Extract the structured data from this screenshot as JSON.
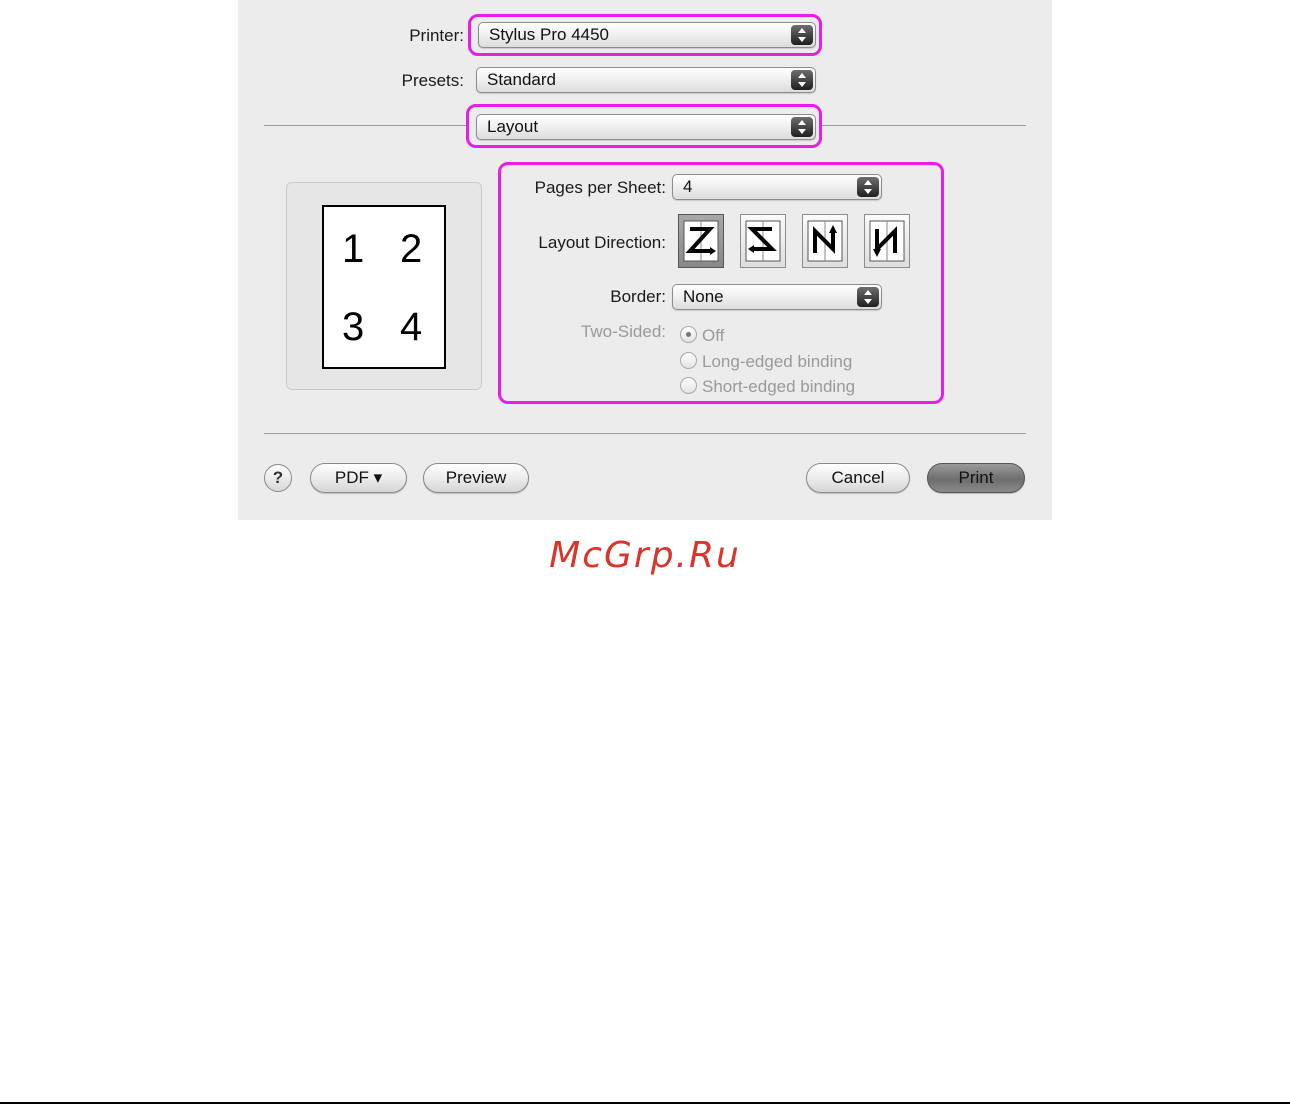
{
  "printer": {
    "label": "Printer:",
    "value": "Stylus Pro 4450"
  },
  "presets": {
    "label": "Presets:",
    "value": "Standard"
  },
  "panel": {
    "value": "Layout"
  },
  "preview": {
    "numbers": [
      "1",
      "2",
      "3",
      "4"
    ]
  },
  "pages_per_sheet": {
    "label": "Pages per Sheet:",
    "value": "4"
  },
  "layout_direction": {
    "label": "Layout Direction:",
    "options": [
      "z-left-to-right-icon",
      "z-right-to-left-icon",
      "n-top-to-bottom-icon",
      "n-reverse-icon"
    ],
    "selected_index": 0
  },
  "border": {
    "label": "Border:",
    "value": "None"
  },
  "two_sided": {
    "label": "Two-Sided:",
    "options": [
      "Off",
      "Long-edged binding",
      "Short-edged binding"
    ],
    "selected": "Off"
  },
  "buttons": {
    "help": "?",
    "pdf": "PDF ▾",
    "preview": "Preview",
    "cancel": "Cancel",
    "print": "Print"
  },
  "watermark": "McGrp.Ru",
  "colors": {
    "highlight": "#e81ee8",
    "watermark": "#d8362b",
    "dialog_bg": "#ececec"
  }
}
